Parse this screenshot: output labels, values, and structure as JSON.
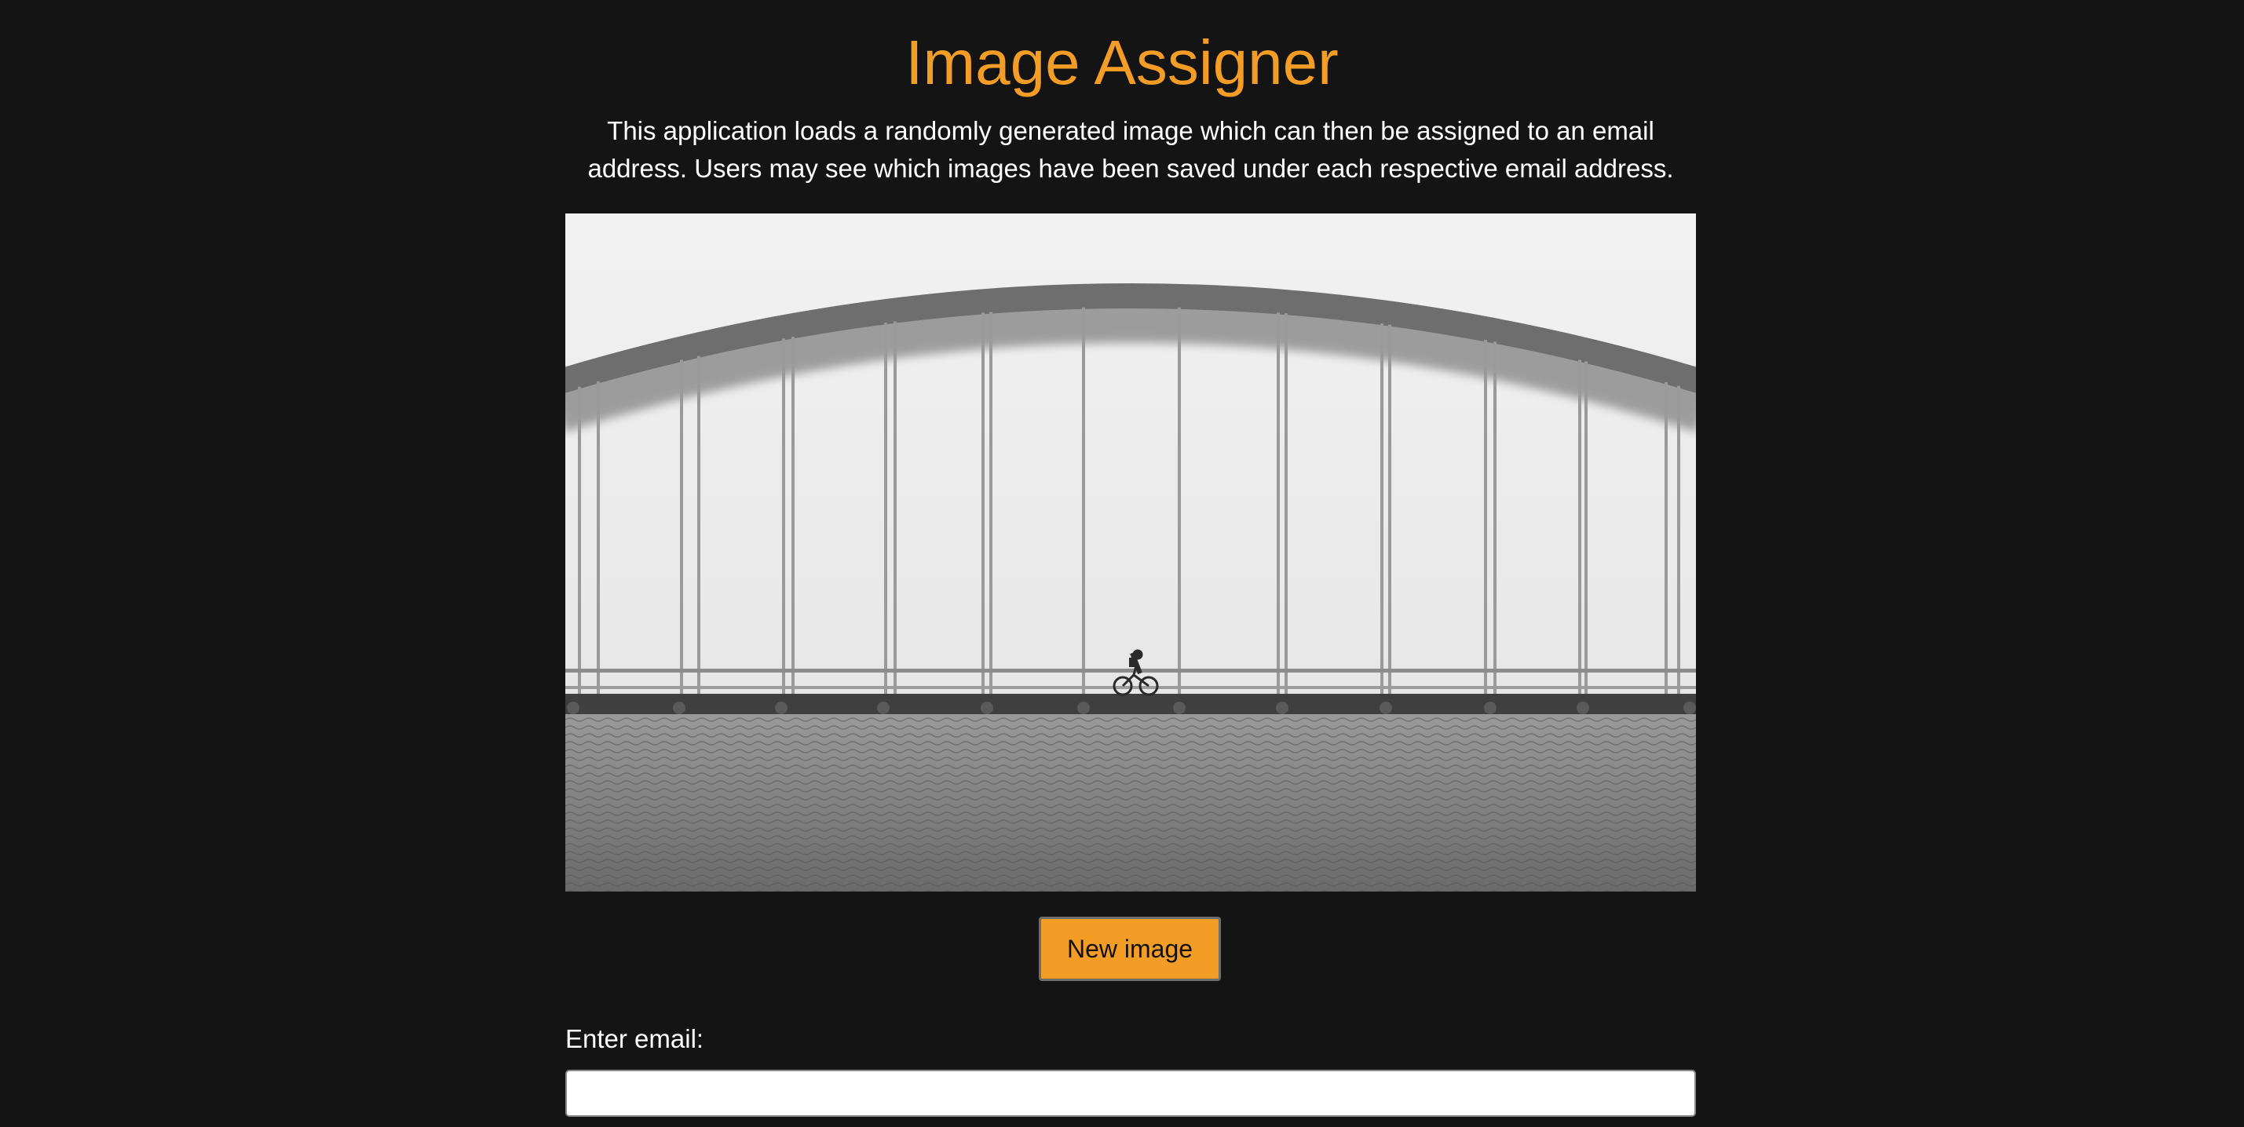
{
  "header": {
    "title": "Image Assigner",
    "description": "This application loads a randomly generated image which can then be assigned to an email address. Users may see which images have been saved under each respective email address."
  },
  "image": {
    "subject": "grayscale photo of a cyclist riding across an arch bridge over water"
  },
  "actions": {
    "new_image_label": "New image"
  },
  "form": {
    "email_label": "Enter email:",
    "email_value": "",
    "email_placeholder": ""
  },
  "colors": {
    "background": "#141414",
    "accent": "#f39c26",
    "text": "#ffffff"
  }
}
